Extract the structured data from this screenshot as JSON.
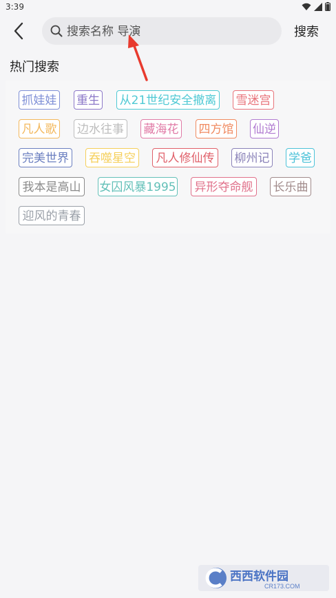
{
  "status_bar": {
    "time": "3:39"
  },
  "header": {
    "back_icon": "chevron-left-icon",
    "search_placeholder": "搜索名称 导演",
    "search_button": "搜索"
  },
  "hot_search": {
    "title": "热门搜索",
    "tags": [
      {
        "label": "抓娃娃",
        "color": "#7e8fd6"
      },
      {
        "label": "重生",
        "color": "#8c78c8"
      },
      {
        "label": "从21世纪安全撤离",
        "color": "#4fc9d4"
      },
      {
        "label": "雪迷宫",
        "color": "#e8737a"
      },
      {
        "label": "凡人歌",
        "color": "#f3b85c"
      },
      {
        "label": "边水往事",
        "color": "#bdbdbd"
      },
      {
        "label": "藏海花",
        "color": "#e07aa6"
      },
      {
        "label": "四方馆",
        "color": "#f08a60"
      },
      {
        "label": "仙逆",
        "color": "#b07ad0"
      },
      {
        "label": "完美世界",
        "color": "#6b7fc0"
      },
      {
        "label": "吞噬星空",
        "color": "#f5cf5a"
      },
      {
        "label": "凡人修仙传",
        "color": "#e0606a"
      },
      {
        "label": "柳州记",
        "color": "#8a82b8"
      },
      {
        "label": "学爸",
        "color": "#4cc2d8"
      },
      {
        "label": "我本是高山",
        "color": "#8a8a8a"
      },
      {
        "label": "女囚风暴1995",
        "color": "#63c0b8"
      },
      {
        "label": "异形夺命舰",
        "color": "#e0708a"
      },
      {
        "label": "长乐曲",
        "color": "#a08a8a"
      },
      {
        "label": "迎风的青春",
        "color": "#9aa0a8"
      }
    ]
  },
  "watermark": {
    "brand": "西西软件园",
    "url": "CR173.COM"
  },
  "colors": {
    "background": "#f5f5f7",
    "search_bg": "#e9e9ec",
    "arrow": "#e83a2e"
  }
}
